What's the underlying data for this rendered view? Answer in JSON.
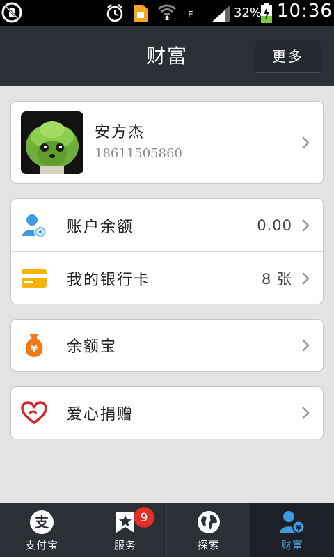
{
  "status_bar": {
    "battery_percent": "32%",
    "network_type": "E",
    "time": "10:36",
    "icons": [
      "no-sim-icon",
      "alarm-icon",
      "sim-card-icon",
      "wifi-icon",
      "signal-icon",
      "battery-charging-icon"
    ]
  },
  "header": {
    "title": "财富",
    "more_label": "更多"
  },
  "profile": {
    "name": "安方杰",
    "phone": "18611505860"
  },
  "account": {
    "balance_label": "账户余额",
    "balance_value": "0.00",
    "bank_card_label": "我的银行卡",
    "bank_card_value": "8 张"
  },
  "yeb": {
    "label": "余额宝"
  },
  "donate": {
    "label": "爱心捐赠"
  },
  "bottom_nav": {
    "items": [
      {
        "label": "支付宝",
        "icon": "alipay-icon",
        "active": false
      },
      {
        "label": "服务",
        "icon": "star-bookmark-icon",
        "badge": "9",
        "active": false
      },
      {
        "label": "探索",
        "icon": "globe-icon",
        "active": false
      },
      {
        "label": "财富",
        "icon": "wealth-user-icon",
        "active": true
      }
    ]
  },
  "colors": {
    "header_bg": "#2b2f36",
    "page_bg": "#e3e3e3",
    "accent_blue": "#4aa3e0",
    "badge_red": "#e0302a",
    "card_yellow": "#f5b400",
    "yeb_orange": "#f07a1a",
    "heart_red": "#d9242b"
  }
}
